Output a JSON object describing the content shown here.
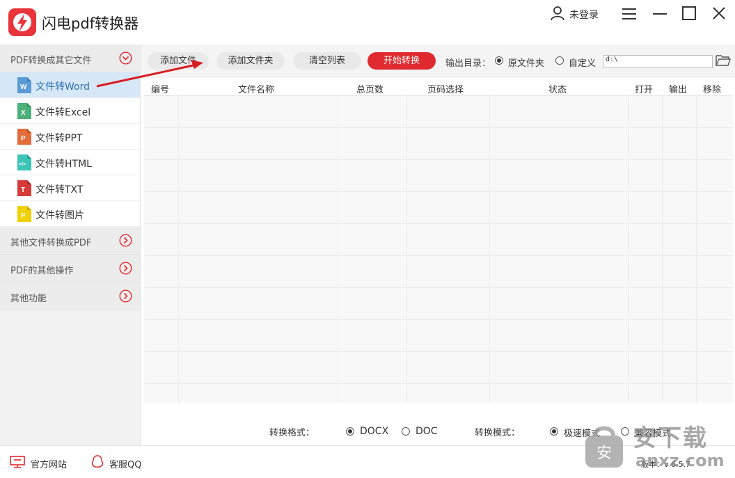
{
  "app": {
    "title": "闪电pdf转换器",
    "accent": "#e02a2f",
    "logo": "lightning-logo"
  },
  "user": {
    "label": "未登录",
    "icon": "user-icon"
  },
  "window_controls": [
    "menu-icon",
    "minimize-icon",
    "maximize-icon",
    "close-icon"
  ],
  "sidebar": {
    "groups": [
      {
        "label": "PDF转换成其它文件",
        "expanded": true,
        "items": [
          {
            "label": "文件转Word",
            "icon": "word-file-icon",
            "color": "#5b9bd5",
            "letter": "W",
            "active": true
          },
          {
            "label": "文件转Excel",
            "icon": "excel-file-icon",
            "color": "#4cb07a",
            "letter": "X",
            "active": false
          },
          {
            "label": "文件转PPT",
            "icon": "ppt-file-icon",
            "color": "#e36c3a",
            "letter": "P",
            "active": false
          },
          {
            "label": "文件转HTML",
            "icon": "html-file-icon",
            "color": "#3cc4b4",
            "letter": "</>",
            "active": false
          },
          {
            "label": "文件转TXT",
            "icon": "txt-file-icon",
            "color": "#d83a3a",
            "letter": "T",
            "active": false
          },
          {
            "label": "文件转图片",
            "icon": "image-file-icon",
            "color": "#e6c200",
            "letter": "P",
            "active": false
          }
        ]
      },
      {
        "label": "其他文件转换成PDF",
        "expanded": false
      },
      {
        "label": "PDF的其他操作",
        "expanded": false
      },
      {
        "label": "其他功能",
        "expanded": false
      }
    ]
  },
  "toolbar": {
    "add_file": "添加文件",
    "add_folder": "添加文件夹",
    "clear_list": "清空列表",
    "start": "开始转换",
    "output_label": "输出目录：",
    "output_options": [
      {
        "label": "原文件夹",
        "selected": true
      },
      {
        "label": "自定义",
        "selected": false
      }
    ],
    "path_value": "d:\\"
  },
  "table": {
    "columns": [
      "编号",
      "文件名称",
      "总页数",
      "页码选择",
      "状态",
      "打开",
      "输出",
      "移除"
    ],
    "rows": []
  },
  "options": {
    "format_label": "转换格式：",
    "formats": [
      {
        "label": "DOCX",
        "selected": true
      },
      {
        "label": "DOC",
        "selected": false
      }
    ],
    "mode_label": "转换模式：",
    "modes": [
      {
        "label": "极速模式",
        "selected": true
      },
      {
        "label": "兼容模式",
        "selected": false
      }
    ]
  },
  "statusbar": {
    "website": "官方网站",
    "qq": "客服QQ",
    "version": "版本：v 6.5.7"
  },
  "watermark": {
    "cn": "安下载",
    "en": "anxz.com"
  }
}
